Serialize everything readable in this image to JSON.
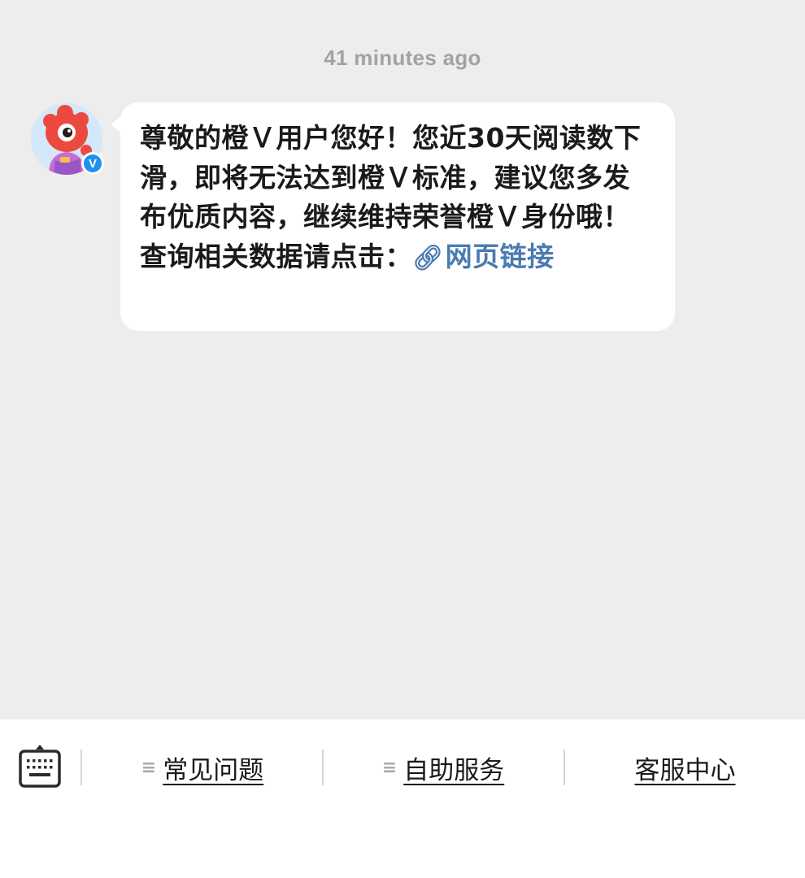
{
  "chat": {
    "timestamp": "41 minutes ago",
    "message": {
      "text": "尊敬的橙Ｖ用户您好！您近30天阅读数下滑，即将无法达到橙Ｖ标准，建议您多发布优质内容，继续维持荣誉橙Ｖ身份哦！查询相关数据请点击：",
      "link_label": "网页链接",
      "link_icon": "link-icon"
    },
    "avatar": {
      "badge_label": "V",
      "badge_color": "#1e90f0"
    }
  },
  "bottom_bar": {
    "keyboard_icon": "keyboard-icon",
    "menu_items": [
      {
        "label": "常见问题",
        "icon": "menu-lines-icon"
      },
      {
        "label": "自助服务",
        "icon": "menu-lines-icon"
      },
      {
        "label": "客服中心"
      }
    ]
  },
  "colors": {
    "background": "#ededed",
    "bubble": "#ffffff",
    "link": "#4a7bb0",
    "timestamp": "#a2a2a2"
  }
}
